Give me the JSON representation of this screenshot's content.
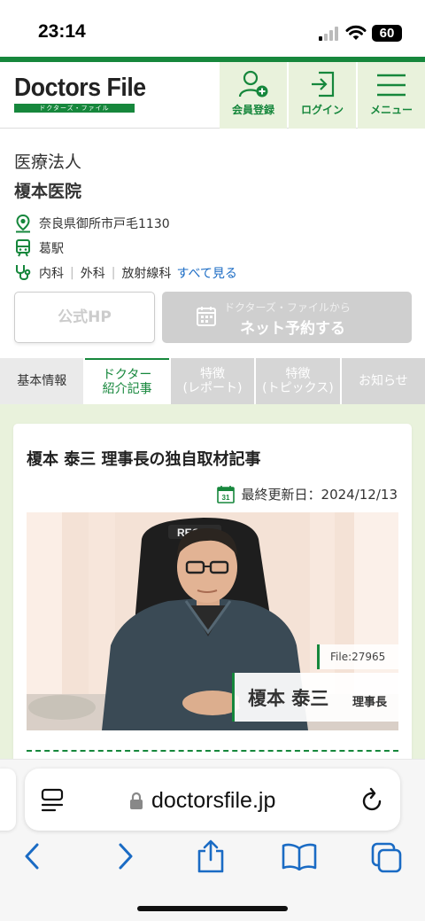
{
  "status": {
    "time": "23:14",
    "battery": "60"
  },
  "header": {
    "logo_text": "Doctors File",
    "logo_sub": "ドクターズ・ファイル",
    "register_label": "会員登録",
    "login_label": "ログイン",
    "menu_label": "メニュー"
  },
  "clinic": {
    "corp": "医療法人",
    "name": "榎本医院",
    "address": "奈良県御所市戸毛1130",
    "station": "葛駅",
    "departments": [
      "内科",
      "外科",
      "放射線科"
    ],
    "see_all": "すべて見る"
  },
  "actions": {
    "official_hp": "公式HP",
    "reserve_sub": "ドクターズ・ファイルから",
    "reserve_main": "ネット予約する"
  },
  "tabs": [
    {
      "line1": "基本情報",
      "line2": ""
    },
    {
      "line1": "ドクター",
      "line2": "紹介記事"
    },
    {
      "line1": "特徴",
      "line2": "(レポート)"
    },
    {
      "line1": "特徴",
      "line2": "(トピックス)"
    },
    {
      "line1": "お知らせ",
      "line2": ""
    }
  ],
  "article": {
    "title": "榎本 泰三 理事長の独自取材記事",
    "calendar_day": "31",
    "updated": "最終更新日：2024/12/13",
    "file_no": "File:27965",
    "doctor_name": "榎本 泰三",
    "doctor_position": "理事長"
  },
  "browser": {
    "url": "doctorsfile.jp"
  },
  "colors": {
    "brand_green": "#16873c",
    "pale_green": "#e9f2dc",
    "link_blue": "#1a6bc4"
  }
}
